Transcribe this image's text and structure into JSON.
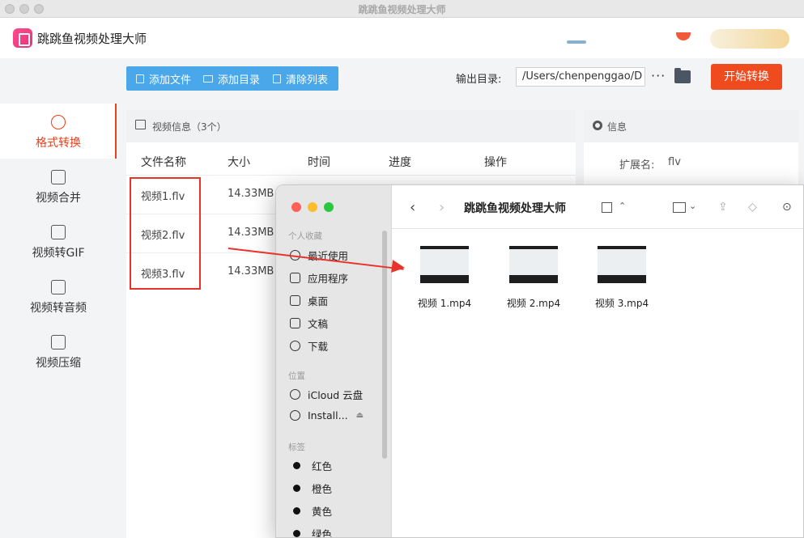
{
  "window": {
    "title": "跳跳鱼视频处理大师"
  },
  "app": {
    "name": "跳跳鱼视频处理大师"
  },
  "toolbar": {
    "add_file": "添加文件",
    "add_dir": "添加目录",
    "clear_list": "清除列表",
    "output_label": "输出目录:",
    "output_path": "/Users/chenpenggao/D",
    "more": "···",
    "start": "开始转换"
  },
  "sidebar": {
    "items": [
      {
        "label": "格式转换",
        "active": true,
        "icon": "format-convert-icon"
      },
      {
        "label": "视频合并",
        "icon": "merge-icon"
      },
      {
        "label": "视频转GIF",
        "icon": "gif-icon"
      },
      {
        "label": "视频转音频",
        "icon": "audio-icon"
      },
      {
        "label": "视频压缩",
        "icon": "compress-icon"
      }
    ]
  },
  "video_panel": {
    "title": "视频信息（3个）",
    "columns": [
      "文件名称",
      "大小",
      "时间",
      "进度",
      "操作"
    ],
    "rows": [
      {
        "name": "视频1.flv",
        "size": "14.33MB"
      },
      {
        "name": "视频2.flv",
        "size": "14.33MB"
      },
      {
        "name": "视频3.flv",
        "size": "14.33MB"
      }
    ]
  },
  "info_panel": {
    "title": "信息",
    "ext_label": "扩展名:",
    "ext_value": "flv"
  },
  "finder": {
    "title": "跳跳鱼视频处理大师",
    "favorites_header": "个人收藏",
    "favorites": [
      "最近使用",
      "应用程序",
      "桌面",
      "文稿",
      "下载"
    ],
    "locations_header": "位置",
    "locations": [
      "iCloud 云盘",
      "Install..."
    ],
    "tags_header": "标签",
    "tags": [
      "红色",
      "橙色",
      "黄色",
      "绿色"
    ],
    "files": [
      "视频 1.mp4",
      "视频 2.mp4",
      "视频 3.mp4"
    ]
  },
  "colors": {
    "accent": "#e8401c",
    "toolbar_blue": "#4aa8ea",
    "annotation_red": "#e8332a"
  }
}
